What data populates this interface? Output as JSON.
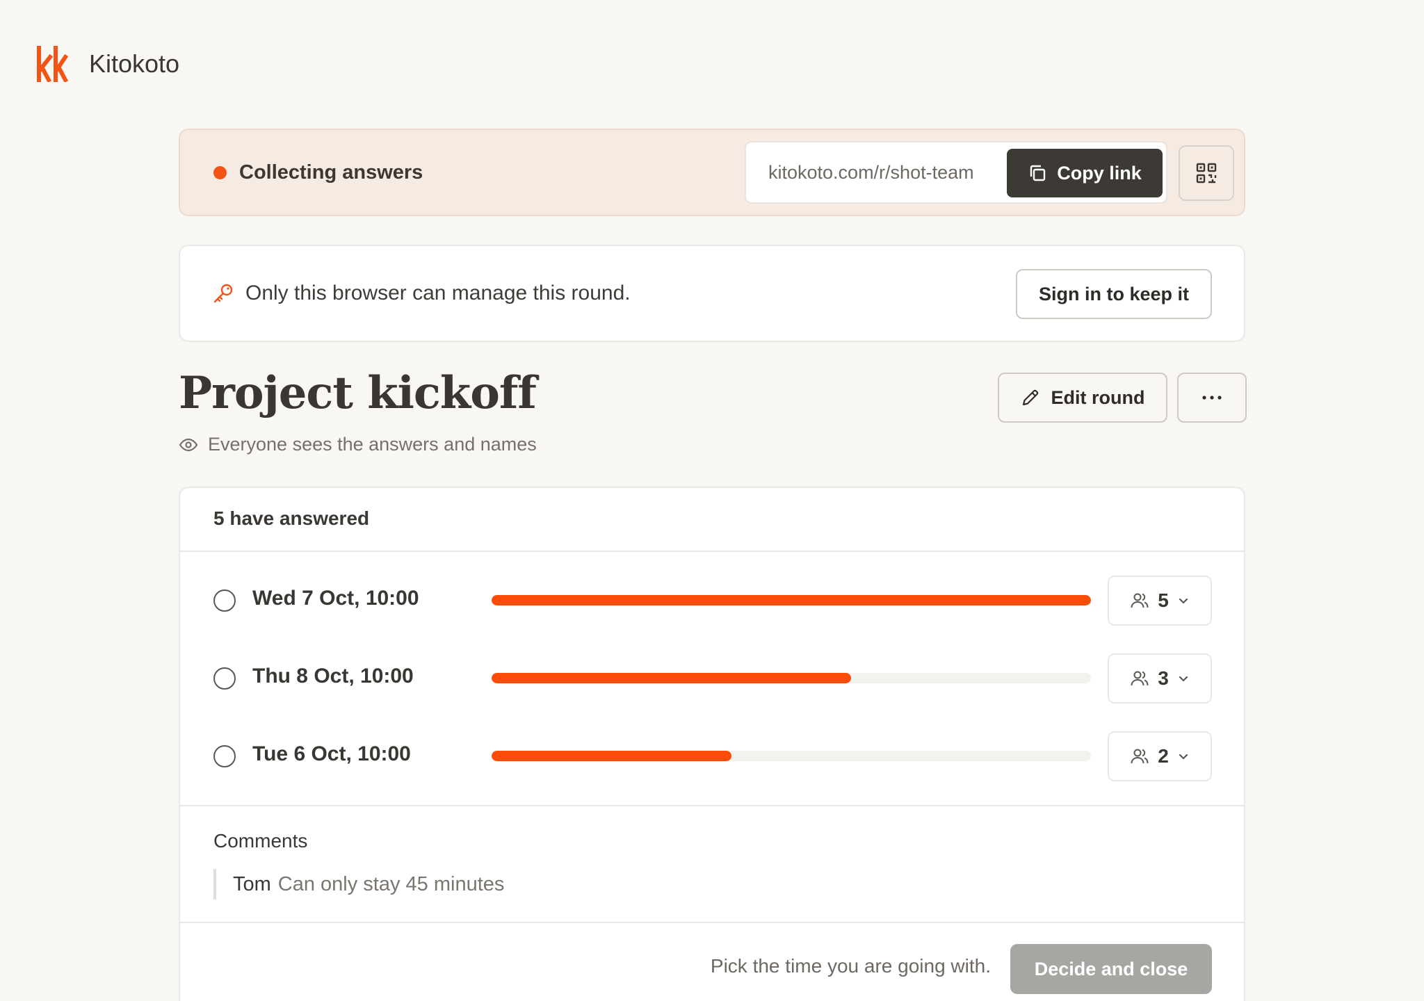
{
  "app": {
    "name": "Kitokoto",
    "brand_color": "#f25416"
  },
  "status": {
    "label": "Collecting answers",
    "link_url": "kitokoto.com/r/shot-team",
    "copy_label": "Copy link",
    "copy_icon": "copy-icon",
    "qr_icon": "qr-code-icon"
  },
  "notice": {
    "icon": "key-icon",
    "text": "Only this browser can manage this round.",
    "signin_label": "Sign in to keep it"
  },
  "round": {
    "title": "Project kickoff",
    "visibility": "Everyone sees the answers and names",
    "edit_label": "Edit round"
  },
  "results": {
    "answered_label": "5 have answered",
    "total": 5,
    "options": [
      {
        "label": "Wed 7 Oct, 10:00",
        "count": "5",
        "fraction": 1.0
      },
      {
        "label": "Thu 8 Oct, 10:00",
        "count": "3",
        "fraction": 0.6
      },
      {
        "label": "Tue 6 Oct, 10:00",
        "count": "2",
        "fraction": 0.4
      }
    ],
    "comments_title": "Comments",
    "comments": [
      {
        "author": "Tom",
        "text": "Can only stay 45 minutes"
      }
    ],
    "footer_hint": "Pick the time you are going with.",
    "decide_label": "Decide and close"
  }
}
